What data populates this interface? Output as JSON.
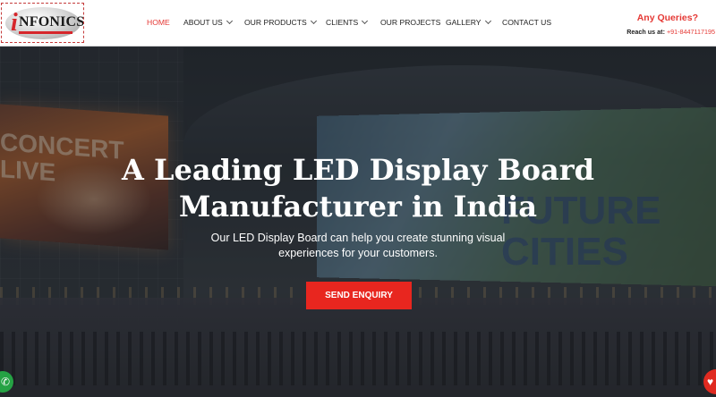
{
  "brand": {
    "logo_i": "i",
    "logo_text": "NFONICS"
  },
  "nav": {
    "items": [
      {
        "label": "HOME",
        "active": true,
        "dropdown": false
      },
      {
        "label": "ABOUT US",
        "active": false,
        "dropdown": true
      },
      {
        "label": "OUR PRODUCTS",
        "active": false,
        "dropdown": true
      },
      {
        "label": "CLIENTS",
        "active": false,
        "dropdown": true
      },
      {
        "label": "OUR PROJECTS",
        "active": false,
        "dropdown": false
      },
      {
        "label": "GALLERY",
        "active": false,
        "dropdown": true
      },
      {
        "label": "CONTACT US",
        "active": false,
        "dropdown": false
      }
    ]
  },
  "contact": {
    "queries_label": "Any Queries?",
    "reach_label": "Reach us at:",
    "phone": "+91-8447117195"
  },
  "hero": {
    "title_line1": "A Leading LED Display Board",
    "title_line2": "Manufacturer in India",
    "subtitle_line1": "Our LED Display Board can help you create stunning visual",
    "subtitle_line2": "experiences for your customers.",
    "cta_label": "SEND ENQUIRY",
    "bg_left_screen_text": "CONCERT LIVE",
    "bg_right_screen_text": "FUTURE CITIES"
  },
  "colors": {
    "accent": "#e53935",
    "cta": "#e8261f",
    "whatsapp": "#25a244"
  },
  "floating": {
    "whatsapp_icon": "whatsapp-icon",
    "heart_icon": "heart-icon"
  }
}
